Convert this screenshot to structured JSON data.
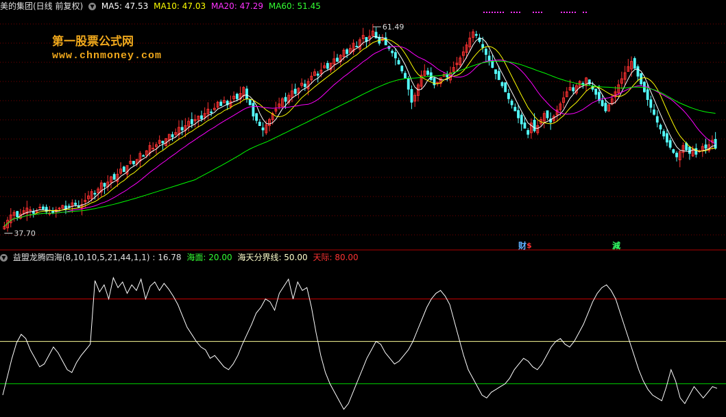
{
  "upper_header": {
    "stock_title": "美的集团(日线 前复权)",
    "ma5": "MA5: 47.53",
    "ma10": "MA10: 47.03",
    "ma20": "MA20: 47.29",
    "ma60": "MA60: 51.45"
  },
  "lower_header": {
    "indicator": "益盟龙腾四海(8,10,10,5,21,44,1,1)",
    "value": ": 16.78",
    "sea_surface": "海面: 20.00",
    "boundary": "海天分界线: 50.00",
    "sky": "天际: 80.00"
  },
  "watermark": {
    "line1": "第一股票公式网",
    "line2": "www.chnmoney.com"
  },
  "markers": {
    "cai": "财",
    "s": "$",
    "jian": "減"
  },
  "colors": {
    "up": "#ff3232",
    "down": "#54ffff",
    "ma5": "#ffffff",
    "ma10": "#ffff00",
    "ma20": "#ff00ff",
    "ma60": "#00ff00",
    "grid": "#7a0000",
    "separator": "#b00000",
    "sky_line": "#cc0000",
    "boundary_line": "#ffff99",
    "sea_line": "#00cc00",
    "watermark": "#f0a81c"
  },
  "chart_data": [
    {
      "type": "candlestick",
      "title": "美的集团(日线 前复权)",
      "ylim": [
        36.8,
        63.0
      ],
      "annotations": [
        {
          "label": "61.49",
          "value": 61.49,
          "kind": "high"
        },
        {
          "label": "37.70",
          "value": 37.7,
          "kind": "low"
        }
      ],
      "ma_latest": {
        "MA5": 47.53,
        "MA10": 47.03,
        "MA20": 47.29,
        "MA60": 51.45
      },
      "close": [
        38.5,
        39.2,
        39.8,
        40.1,
        39.6,
        39.9,
        40.3,
        40.6,
        40.4,
        40.0,
        40.3,
        40.7,
        40.5,
        40.2,
        40.0,
        40.1,
        40.4,
        40.6,
        40.9,
        40.5,
        40.8,
        41.2,
        41.0,
        40.7,
        41.0,
        41.5,
        42.0,
        42.5,
        42.2,
        42.8,
        43.5,
        43.1,
        43.6,
        44.2,
        43.9,
        44.5,
        45.1,
        44.8,
        45.5,
        46.0,
        45.7,
        46.2,
        46.9,
        46.6,
        47.2,
        47.8,
        47.5,
        47.9,
        48.4,
        48.1,
        48.6,
        49.1,
        48.8,
        49.3,
        49.9,
        49.6,
        50.1,
        50.6,
        50.3,
        50.8,
        51.2,
        50.9,
        51.5,
        52.0,
        51.6,
        52.1,
        52.8,
        52.4,
        53.0,
        52.5,
        52.9,
        53.5,
        53.2,
        53.8,
        54.5,
        53.2,
        52.5,
        51.2,
        50.7,
        50.1,
        49.6,
        50.2,
        50.8,
        51.5,
        52.0,
        52.6,
        53.2,
        52.9,
        53.6,
        54.1,
        53.8,
        54.4,
        55.0,
        54.6,
        55.2,
        55.8,
        56.3,
        55.9,
        56.5,
        57.0,
        56.7,
        57.3,
        57.8,
        57.5,
        58.2,
        58.8,
        58.4,
        59.0,
        59.6,
        59.2,
        60.0,
        60.5,
        59.8,
        60.4,
        61.0,
        60.2,
        59.6,
        60.1,
        59.4,
        59.0,
        58.5,
        57.9,
        57.2,
        56.4,
        55.6,
        54.3,
        52.8,
        53.6,
        54.8,
        55.9,
        56.4,
        56.0,
        55.4,
        54.8,
        55.1,
        55.6,
        56.0,
        55.7,
        56.2,
        56.8,
        57.3,
        57.9,
        58.6,
        59.4,
        60.2,
        60.9,
        60.5,
        59.8,
        59.1,
        58.3,
        57.6,
        56.8,
        56.1,
        55.4,
        54.7,
        54.0,
        53.2,
        52.5,
        51.8,
        51.0,
        50.3,
        49.8,
        49.1,
        50.4,
        49.5,
        50.1,
        50.8,
        51.5,
        51.0,
        50.5,
        51.2,
        51.9,
        52.6,
        53.3,
        54.0,
        54.5,
        54.1,
        54.7,
        55.2,
        54.8,
        55.6,
        54.9,
        54.3,
        53.7,
        53.0,
        52.4,
        51.8,
        52.5,
        53.2,
        54.0,
        54.8,
        55.5,
        56.2,
        56.9,
        57.5,
        56.7,
        55.8,
        54.9,
        54.0,
        53.1,
        52.2,
        51.4,
        50.5,
        49.7,
        48.9,
        48.2,
        47.6,
        47.0,
        46.5,
        47.1,
        47.8,
        47.3,
        46.9,
        47.4,
        46.8,
        47.2,
        47.7,
        47.5,
        47.9,
        48.4,
        47.5
      ]
    },
    {
      "type": "line",
      "title": "益盟龙腾四海(8,10,10,5,21,44,1,1)",
      "ylim": [
        -3,
        105
      ],
      "reference_lines": [
        {
          "name": "海面",
          "value": 20
        },
        {
          "name": "海天分界线",
          "value": 50
        },
        {
          "name": "天际",
          "value": 80
        }
      ],
      "latest": 16.78,
      "values": [
        12,
        25,
        38,
        49,
        55,
        52,
        44,
        38,
        32,
        34,
        40,
        46,
        42,
        36,
        30,
        28,
        35,
        40,
        44,
        48,
        93,
        85,
        90,
        80,
        95,
        88,
        92,
        84,
        90,
        86,
        94,
        80,
        89,
        92,
        86,
        91,
        87,
        82,
        76,
        68,
        60,
        55,
        50,
        46,
        44,
        38,
        40,
        36,
        32,
        30,
        34,
        40,
        48,
        55,
        62,
        70,
        74,
        80,
        78,
        72,
        84,
        89,
        94,
        80,
        92,
        86,
        88,
        74,
        56,
        40,
        28,
        20,
        14,
        8,
        2,
        6,
        14,
        22,
        30,
        38,
        44,
        50,
        48,
        42,
        38,
        34,
        36,
        40,
        44,
        50,
        58,
        66,
        74,
        80,
        84,
        86,
        82,
        76,
        64,
        52,
        40,
        30,
        24,
        18,
        12,
        10,
        14,
        16,
        18,
        20,
        24,
        30,
        34,
        38,
        36,
        32,
        30,
        34,
        40,
        46,
        50,
        52,
        48,
        46,
        50,
        56,
        62,
        70,
        78,
        84,
        88,
        90,
        86,
        80,
        70,
        60,
        50,
        40,
        30,
        22,
        16,
        12,
        10,
        8,
        18,
        30,
        22,
        10,
        6,
        12,
        18,
        14,
        10,
        14,
        18,
        16.78
      ]
    }
  ]
}
